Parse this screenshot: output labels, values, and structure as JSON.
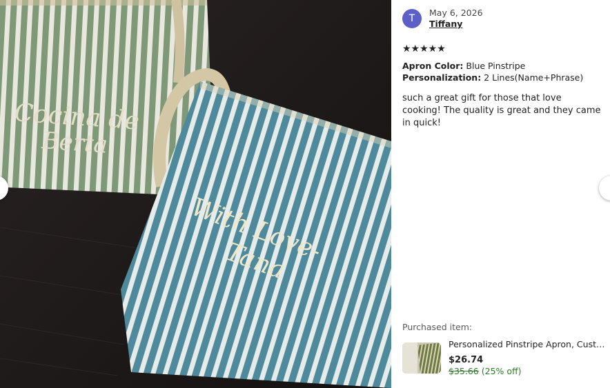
{
  "review": {
    "avatar_letter": "T",
    "date": "May 6, 2026",
    "username": "Tiffany",
    "stars": "★★★★★",
    "rating": 5,
    "attributes": [
      {
        "label": "Apron Color:",
        "value": "Blue Pinstripe"
      },
      {
        "label": "Personalization:",
        "value": "2 Lines(Name+Phrase)"
      }
    ],
    "text": "such a great gift for those that love cooking! The quality is great and they came in quick!"
  },
  "photo": {
    "green_apron_text_line1": "Cocina de",
    "green_apron_text_line2": "Berta",
    "blue_apron_text_line1": "With Love-",
    "blue_apron_text_line2": "Tana"
  },
  "purchased": {
    "label": "Purchased item:",
    "title": "Personalized Pinstripe Apron, Customized Apron, Personalized Gift",
    "price": "$26.74",
    "original_price": "$35.66",
    "discount": "(25% off)"
  },
  "colors": {
    "avatar": "#5b5fc7",
    "discount_green": "#2e7a27",
    "green_stripe": "#7f9978",
    "blue_stripe": "#4e8a9b",
    "background_wood": "#1e1a1a"
  },
  "icons": {
    "prev": "chevron-left-icon",
    "next": "chevron-right-icon"
  }
}
